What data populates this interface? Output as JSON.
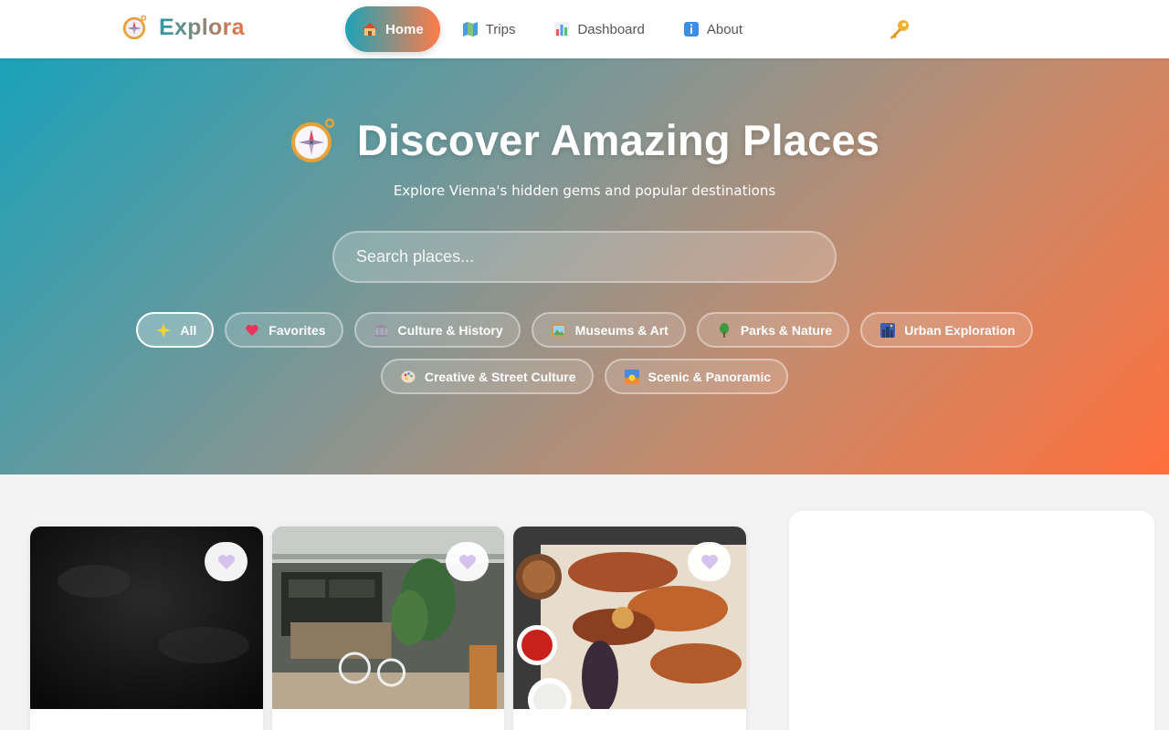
{
  "brand": {
    "name": "Explora",
    "icon": "compass-icon"
  },
  "nav": {
    "items": [
      {
        "label": "Home",
        "icon": "house-icon",
        "active": true
      },
      {
        "label": "Trips",
        "icon": "map-icon",
        "active": false
      },
      {
        "label": "Dashboard",
        "icon": "bar-chart-icon",
        "active": false
      },
      {
        "label": "About",
        "icon": "info-icon",
        "active": false
      }
    ],
    "login_icon": "key-icon"
  },
  "hero": {
    "title": "Discover Amazing Places",
    "subtitle": "Explore Vienna's hidden gems and popular destinations",
    "search_placeholder": "Search places..."
  },
  "filters": [
    {
      "label": "All",
      "icon": "sparkle-icon",
      "active": true
    },
    {
      "label": "Favorites",
      "icon": "heart-icon",
      "active": false
    },
    {
      "label": "Culture & History",
      "icon": "classical-building-icon",
      "active": false
    },
    {
      "label": "Museums & Art",
      "icon": "framed-picture-icon",
      "active": false
    },
    {
      "label": "Parks & Nature",
      "icon": "tree-icon",
      "active": false
    },
    {
      "label": "Urban Exploration",
      "icon": "city-night-icon",
      "active": false
    },
    {
      "label": "Creative & Street Culture",
      "icon": "palette-icon",
      "active": false
    },
    {
      "label": "Scenic & Panoramic",
      "icon": "sunrise-icon",
      "active": false
    }
  ],
  "places": [
    {
      "image": "dark-texture-photo",
      "favorite": false
    },
    {
      "image": "cafe-interior-photo",
      "favorite": false
    },
    {
      "image": "grilled-meat-platter-photo",
      "favorite": false
    }
  ],
  "colors": {
    "accent_teal": "#1ea3b6",
    "accent_orange": "#ff7b4a"
  }
}
